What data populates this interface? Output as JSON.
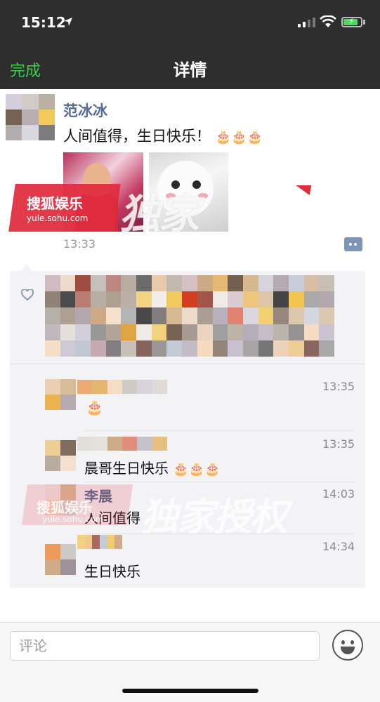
{
  "status_bar": {
    "time": "15:12"
  },
  "nav": {
    "done_label": "完成",
    "title": "详情"
  },
  "post": {
    "author": "范冰冰",
    "text": "人间值得，生日快乐！",
    "emoji": "🎂🎂🎂",
    "time": "13:33",
    "watermark": {
      "brand": "搜狐娱乐",
      "url": "yule.sohu.com",
      "overlay": "独家"
    }
  },
  "comments": [
    {
      "name": "",
      "text": "🎂",
      "time": "13:35"
    },
    {
      "name": "",
      "text": "晨哥生日快乐",
      "emoji": "🎂🎂🎂",
      "time": "13:35"
    },
    {
      "name": "李晨",
      "text": "人间值得",
      "time": "14:03"
    },
    {
      "name": "",
      "text": "生日快乐",
      "time": "14:34"
    }
  ],
  "watermark2": {
    "brand": "搜狐娱乐",
    "url": "yule.sohu.com",
    "overlay": "独家授权"
  },
  "input": {
    "placeholder": "评论"
  },
  "colors": {
    "nav_bg": "#2e2e2e",
    "done_green": "#3ccf4e",
    "link_blue": "#576b95",
    "panel_bg": "#f3f3f5",
    "sohu_red": "#e02b3d"
  },
  "icons": [
    "location-arrow-icon",
    "signal-icon",
    "wifi-icon",
    "battery-icon",
    "heart-icon",
    "more-icon",
    "emoji-icon"
  ]
}
